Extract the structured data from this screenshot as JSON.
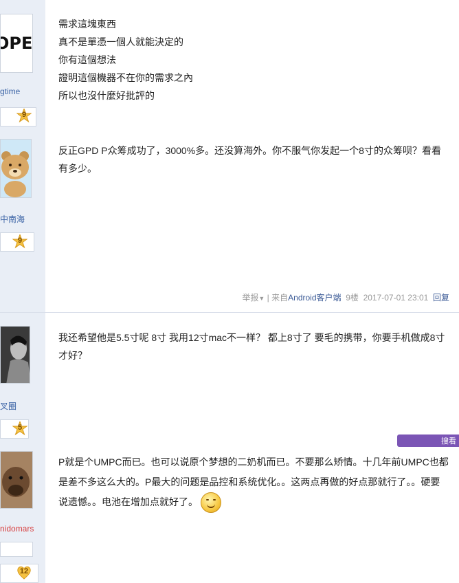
{
  "posts": [
    {
      "author": "gtime",
      "level": "9",
      "avatar_text": "OPE",
      "lines": [
        "需求這塊東西",
        "真不是單憑一個人就能決定的",
        "你有這個想法",
        "證明這個機器不在你的需求之內",
        "所以也沒什麼好批評的"
      ]
    },
    {
      "author": "中南海",
      "level": "9",
      "lines": [
        "反正GPD P众筹成功了，3000%多。还没算海外。你不服气你发起一个8寸的众筹呗？看看有多少。"
      ],
      "meta": {
        "report": "举报",
        "separator": "|",
        "from_prefix": "来自",
        "client": "Android客户端",
        "floor": "9楼",
        "time": "2017-07-01 23:01",
        "reply": "回复"
      }
    },
    {
      "author": "叉圈",
      "level": "5",
      "lines": [
        "我还希望他是5.5寸呢 8寸 我用12寸mac不一样？ 都上8寸了 要毛的携带，你要手机做成8寸才好？"
      ]
    },
    {
      "author": "nidomars",
      "level": "12",
      "lines": [
        "P就是个UMPC而已。也可以说原个梦想的二奶机而已。不要那么矫情。十几年前UMPC也都是差不多这么大的。P最大的问题是品控和系统优化。。这两点再做的好点那就行了。。硬要说遗憾。。电池在增加点就好了。"
      ],
      "tag": "搜看"
    }
  ],
  "colors": {
    "link": "#3b5a96",
    "sidebar": "#e9eef6",
    "badge": "#f5c242"
  }
}
